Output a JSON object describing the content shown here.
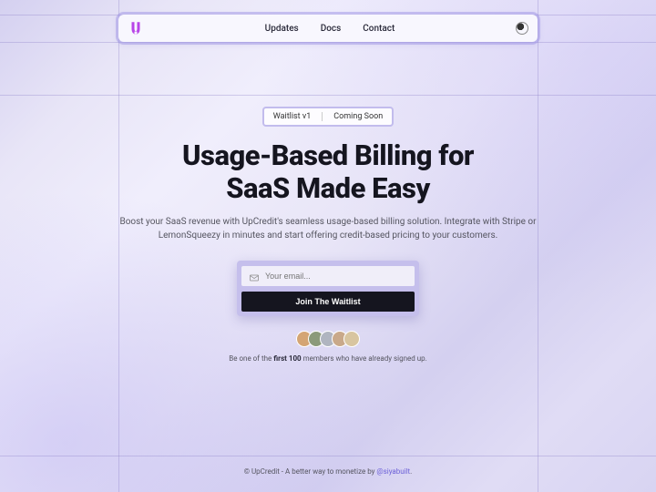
{
  "nav": {
    "links": [
      "Updates",
      "Docs",
      "Contact"
    ]
  },
  "badge": {
    "left": "Waitlist v1",
    "right": "Coming Soon"
  },
  "hero": {
    "title_line1": "Usage-Based Billing for",
    "title_line2": "SaaS Made Easy",
    "subtitle": "Boost your SaaS revenue with UpCredit's seamless usage-based billing solution. Integrate with Stripe or LemonSqueezy in minutes and start offering credit-based pricing to your customers."
  },
  "form": {
    "placeholder": "Your email...",
    "button": "Join The Waitlist"
  },
  "social": {
    "prefix": "Be one of the ",
    "bold": "first 100",
    "suffix": " members who have already signed up."
  },
  "footer": {
    "text": "© UpCredit - A better way to monetize by ",
    "handle": "@siyabuilt",
    "dot": "."
  }
}
